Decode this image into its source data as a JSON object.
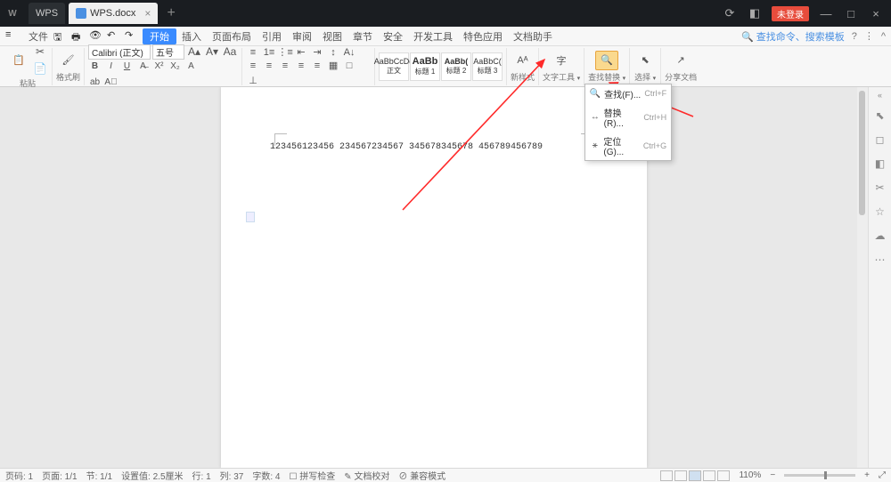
{
  "titlebar": {
    "app_label": "WPS",
    "doc_tab": "WPS.docx",
    "login_label": "未登录"
  },
  "menubar": {
    "file": "文件",
    "items": [
      "开始",
      "插入",
      "页面布局",
      "引用",
      "审阅",
      "视图",
      "章节",
      "安全",
      "开发工具",
      "特色应用",
      "文档助手"
    ],
    "search_link": "查找命令、搜索模板"
  },
  "ribbon": {
    "paste_label": "粘贴",
    "copy_label": "复制",
    "format_painter_label": "格式刷",
    "font_name": "Calibri (正文)",
    "font_size": "五号",
    "styles": [
      {
        "preview": "AaBbCcDd",
        "name": "正文"
      },
      {
        "preview": "AaBb",
        "name": "标题 1"
      },
      {
        "preview": "AaBb(",
        "name": "标题 2"
      },
      {
        "preview": "AaBbC(",
        "name": "标题 3"
      }
    ],
    "new_style_label": "新样式",
    "text_tools_label": "文字工具",
    "find_replace_label": "查找替换",
    "select_label": "选择",
    "share_label": "分享文档"
  },
  "dropdown": {
    "items": [
      {
        "icon": "🔍",
        "label": "查找(F)...",
        "shortcut": "Ctrl+F"
      },
      {
        "icon": "↔",
        "label": "替换(R)...",
        "shortcut": "Ctrl+H"
      },
      {
        "icon": "⚹",
        "label": "定位(G)...",
        "shortcut": "Ctrl+G"
      }
    ]
  },
  "document": {
    "text": "123456123456 234567234567 345678345678 456789456789"
  },
  "statusbar": {
    "page": "页码: 1",
    "pages": "页面: 1/1",
    "section": "节: 1/1",
    "position": "设置值: 2.5厘米",
    "line": "行: 1",
    "col": "列: 37",
    "chars": "字数: 4",
    "spellcheck": "拼写检查",
    "doccheck": "文档校对",
    "compat": "兼容模式",
    "zoom_pct": "110%"
  }
}
